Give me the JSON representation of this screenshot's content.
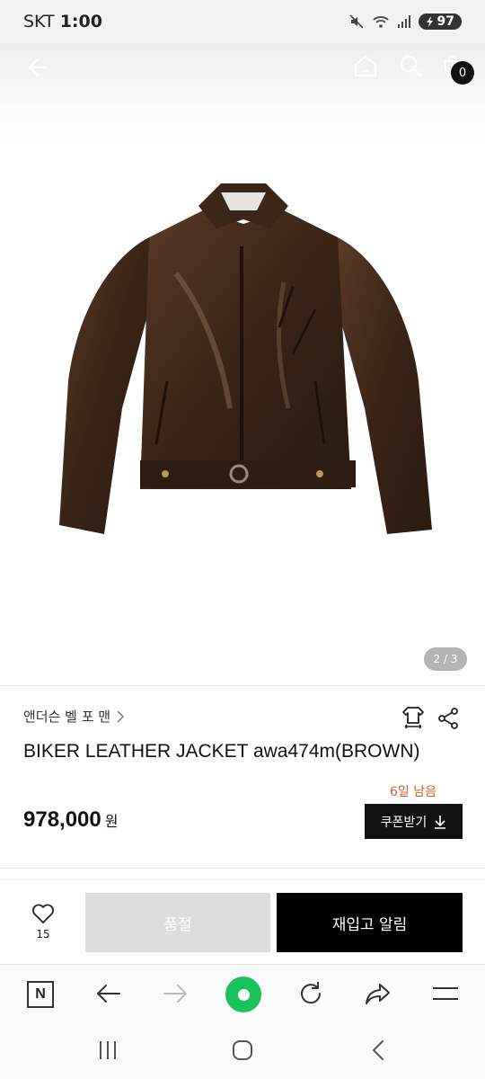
{
  "status_bar": {
    "carrier": "SKT",
    "time": "1:00",
    "battery": "97"
  },
  "gallery": {
    "cart_count": "0",
    "page_indicator": "2 / 3"
  },
  "product": {
    "brand": "앤더슨 벨 포 맨",
    "title": "BIKER LEATHER JACKET awa474m(BROWN)",
    "days_left": "6일 남음",
    "price": "978,000",
    "currency": "원",
    "coupon_label": "쿠폰받기"
  },
  "actions": {
    "wish_count": "15",
    "soldout_label": "품절",
    "restock_label": "재입고 알림"
  },
  "browser_bar": {
    "n_label": "N"
  },
  "colors": {
    "accent_orange": "#c9612a",
    "dark": "#111111",
    "soldout_gray": "#dddddd",
    "green": "#19c25a"
  }
}
